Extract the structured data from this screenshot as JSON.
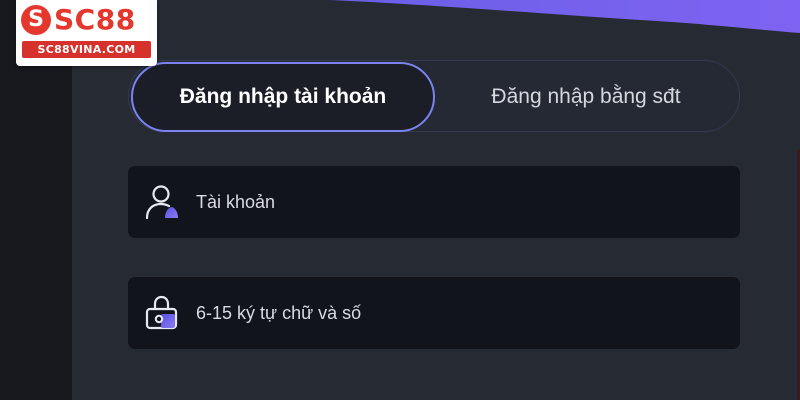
{
  "brand": {
    "logo_text": "SC88",
    "logo_mark": "S",
    "logo_sub": "SC88VINA.COM",
    "color_red": "#e4372d",
    "color_accent": "#7b83f0"
  },
  "tabs": [
    {
      "label": "Đăng nhập tài khoản",
      "active": true
    },
    {
      "label": "Đăng nhập bằng sđt",
      "active": false
    }
  ],
  "form": {
    "username": {
      "placeholder": "Tài khoản",
      "icon": "user-icon"
    },
    "password": {
      "placeholder": "6-15 ký tự chữ và số",
      "icon": "lock-icon"
    }
  }
}
